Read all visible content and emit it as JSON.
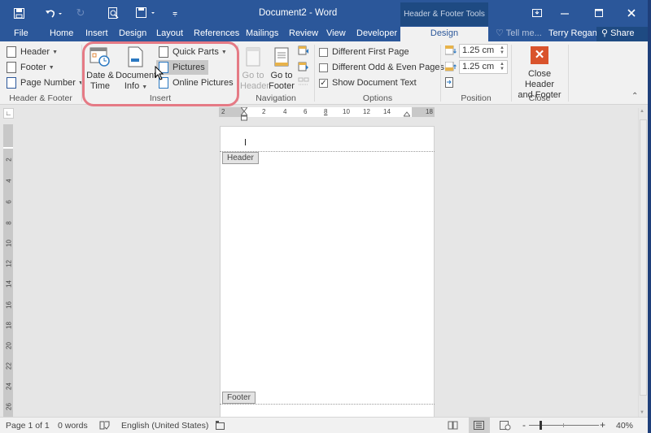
{
  "titlebar": {
    "title": "Document2 - Word",
    "contextual_tab_group": "Header & Footer Tools",
    "quick_access": [
      "save-icon",
      "undo-icon",
      "redo-icon",
      "print-preview-icon",
      "save-as-icon",
      "customize-qat-icon"
    ],
    "window_controls": [
      "ribbon-display-options-icon",
      "minimize-icon",
      "maximize-icon",
      "close-icon"
    ]
  },
  "tabs": {
    "file": "File",
    "home": "Home",
    "insert": "Insert",
    "design": "Design",
    "layout": "Layout",
    "references": "References",
    "mailings": "Mailings",
    "review": "Review",
    "view": "View",
    "developer": "Developer",
    "hf_design": "Design",
    "tell_me": "Tell me...",
    "user": "Terry Regan",
    "share": "Share"
  },
  "ribbon": {
    "header_footer": {
      "label": "Header & Footer",
      "header": "Header",
      "footer": "Footer",
      "page_number": "Page Number"
    },
    "insert": {
      "label": "Insert",
      "date_time_1": "Date &",
      "date_time_2": "Time",
      "doc_info_1": "Document",
      "doc_info_2": "Info",
      "quick_parts": "Quick Parts",
      "pictures": "Pictures",
      "online_pictures": "Online Pictures"
    },
    "navigation": {
      "label": "Navigation",
      "go_header_1": "Go to",
      "go_header_2": "Header",
      "go_footer_1": "Go to",
      "go_footer_2": "Footer"
    },
    "options": {
      "label": "Options",
      "different_first": "Different First Page",
      "different_first_checked": false,
      "different_odd_even": "Different Odd & Even Pages",
      "different_odd_even_checked": false,
      "show_doc_text": "Show Document Text",
      "show_doc_text_checked": true,
      "check_mark": "✓"
    },
    "position": {
      "label": "Position",
      "header_from_top": "1.25 cm",
      "footer_from_bottom": "1.25 cm"
    },
    "close": {
      "label": "Close",
      "close_1": "Close Header",
      "close_2": "and Footer",
      "close_glyph": "✕"
    },
    "collapse_glyph": "⌃"
  },
  "ruler": {
    "horizontal": [
      "2",
      "2",
      "4",
      "6",
      "8",
      "10",
      "12",
      "14",
      "18"
    ],
    "vertical": [
      "2",
      "4",
      "6",
      "8",
      "10",
      "12",
      "14",
      "16",
      "18",
      "20",
      "22",
      "24",
      "26"
    ]
  },
  "document": {
    "header_tag": "Header",
    "footer_tag": "Footer"
  },
  "statusbar": {
    "page": "Page 1 of 1",
    "words": "0 words",
    "language": "English (United States)",
    "zoom": "40%",
    "zoom_minus": "-",
    "zoom_plus": "+",
    "zoom_level_percent": 40
  }
}
